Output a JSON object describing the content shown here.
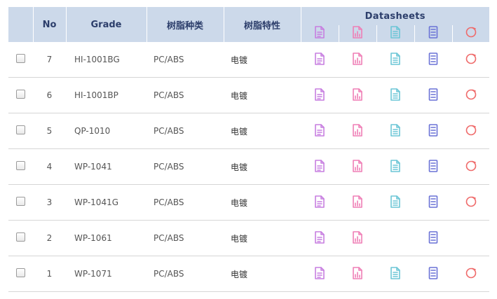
{
  "header": {
    "no": "No",
    "grade": "Grade",
    "resin_type": "树脂种类",
    "resin_property": "树脂特性",
    "datasheets": "Datasheets"
  },
  "icon_columns": [
    {
      "name": "pdf-document-icon",
      "color": "#c77ee0"
    },
    {
      "name": "chart-document-icon",
      "color": "#ef7fb6"
    },
    {
      "name": "text-document-icon",
      "color": "#6cc6d6"
    },
    {
      "name": "form-document-icon",
      "color": "#6a72d6"
    },
    {
      "name": "circle-badge-icon",
      "color": "#ef6a6a"
    }
  ],
  "rows": [
    {
      "no": "7",
      "grade": "HI-1001BG",
      "type": "PC/ABS",
      "property": "电镀",
      "icons": [
        true,
        true,
        true,
        true,
        true
      ]
    },
    {
      "no": "6",
      "grade": "HI-1001BP",
      "type": "PC/ABS",
      "property": "电镀",
      "icons": [
        true,
        true,
        true,
        true,
        true
      ]
    },
    {
      "no": "5",
      "grade": "QP-1010",
      "type": "PC/ABS",
      "property": "电镀",
      "icons": [
        true,
        true,
        true,
        true,
        true
      ]
    },
    {
      "no": "4",
      "grade": "WP-1041",
      "type": "PC/ABS",
      "property": "电镀",
      "icons": [
        true,
        true,
        true,
        true,
        true
      ]
    },
    {
      "no": "3",
      "grade": "WP-1041G",
      "type": "PC/ABS",
      "property": "电镀",
      "icons": [
        true,
        true,
        true,
        true,
        true
      ]
    },
    {
      "no": "2",
      "grade": "WP-1061",
      "type": "PC/ABS",
      "property": "电镀",
      "icons": [
        true,
        true,
        false,
        true,
        false
      ]
    },
    {
      "no": "1",
      "grade": "WP-1071",
      "type": "PC/ABS",
      "property": "电镀",
      "icons": [
        true,
        true,
        true,
        true,
        true
      ]
    }
  ]
}
